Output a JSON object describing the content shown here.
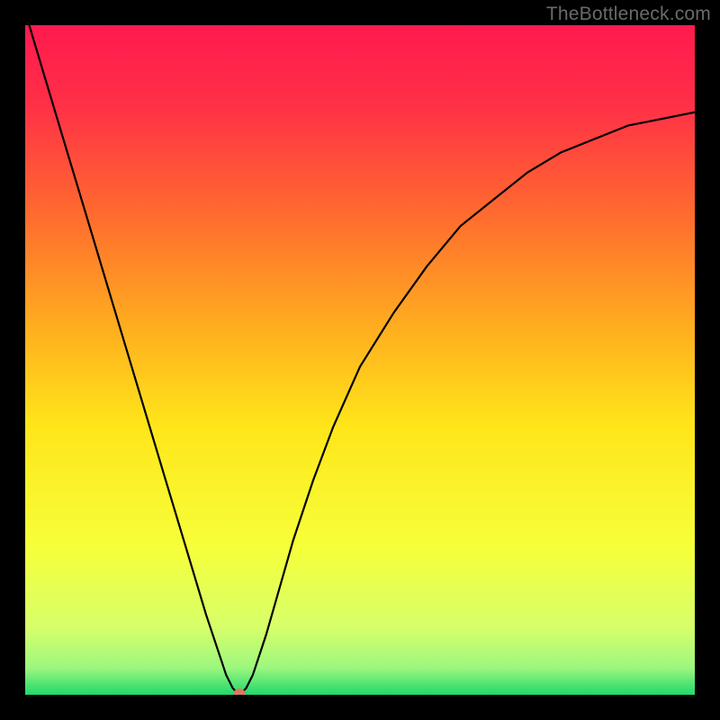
{
  "watermark": "TheBottleneck.com",
  "chart_data": {
    "type": "line",
    "title": "",
    "xlabel": "",
    "ylabel": "",
    "xlim": [
      0,
      100
    ],
    "ylim": [
      0,
      100
    ],
    "grid": false,
    "legend": false,
    "background_gradient": {
      "stops": [
        {
          "offset": 0.0,
          "color": "#ff1a4f"
        },
        {
          "offset": 0.12,
          "color": "#ff3047"
        },
        {
          "offset": 0.28,
          "color": "#ff6a2f"
        },
        {
          "offset": 0.45,
          "color": "#ffad1f"
        },
        {
          "offset": 0.6,
          "color": "#ffe61a"
        },
        {
          "offset": 0.78,
          "color": "#f6ff3a"
        },
        {
          "offset": 0.9,
          "color": "#d6ff6a"
        },
        {
          "offset": 0.96,
          "color": "#9cf77e"
        },
        {
          "offset": 1.0,
          "color": "#1fd86b"
        }
      ]
    },
    "series": [
      {
        "name": "bottleneck-curve",
        "stroke": "#000000",
        "stroke_width": 2.2,
        "x": [
          0,
          3,
          6,
          9,
          12,
          15,
          18,
          21,
          24,
          27,
          30,
          31,
          32,
          33,
          34,
          36,
          38,
          40,
          43,
          46,
          50,
          55,
          60,
          65,
          70,
          75,
          80,
          85,
          90,
          95,
          100
        ],
        "y": [
          102,
          92,
          82,
          72,
          62,
          52,
          42,
          32,
          22,
          12,
          3,
          1,
          0,
          1,
          3,
          9,
          16,
          23,
          32,
          40,
          49,
          57,
          64,
          70,
          74,
          78,
          81,
          83,
          85,
          86,
          87
        ]
      }
    ],
    "marker": {
      "name": "optimum-point",
      "x": 32,
      "y": 0,
      "color": "#d97a63",
      "radius": 7
    }
  }
}
